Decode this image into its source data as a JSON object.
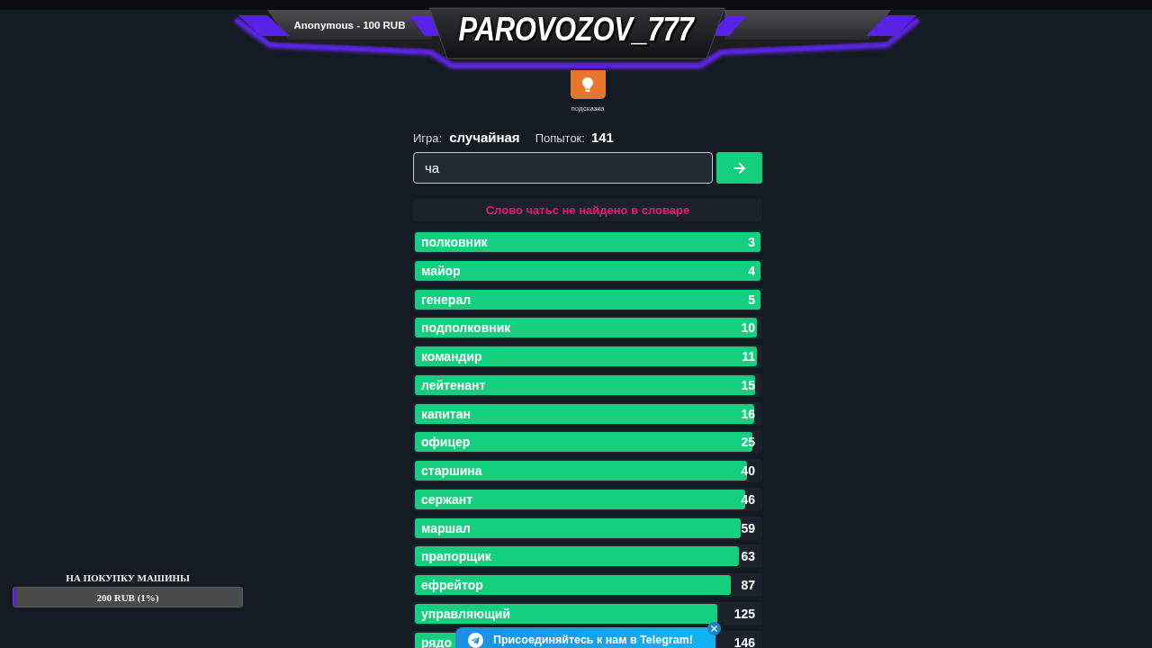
{
  "banner": {
    "subtitle": "Anonymous - 100 RUB",
    "title": "PAROVOZOV_777"
  },
  "hint": {
    "label": "подсказка"
  },
  "game_info": {
    "game_label": "Игра:",
    "game_value": "случайная",
    "attempts_label": "Попыток:",
    "attempts_value": "141"
  },
  "guess_field": {
    "value": "ча"
  },
  "error_message": "Слово чатьс не найдено в словаре",
  "guesses": [
    {
      "word": "полковник",
      "rank": "3",
      "level": 1
    },
    {
      "word": "майор",
      "rank": "4",
      "level": 1
    },
    {
      "word": "генерал",
      "rank": "5",
      "level": 1
    },
    {
      "word": "подполковник",
      "rank": "10",
      "level": 0.99
    },
    {
      "word": "командир",
      "rank": "11",
      "level": 0.99
    },
    {
      "word": "лейтенант",
      "rank": "15",
      "level": 0.985
    },
    {
      "word": "капитан",
      "rank": "16",
      "level": 0.982
    },
    {
      "word": "офицер",
      "rank": "25",
      "level": 0.977
    },
    {
      "word": "старшина",
      "rank": "40",
      "level": 0.961
    },
    {
      "word": "сержант",
      "rank": "46",
      "level": 0.956
    },
    {
      "word": "маршал",
      "rank": "59",
      "level": 0.943
    },
    {
      "word": "прапорщик",
      "rank": "63",
      "level": 0.938
    },
    {
      "word": "ефрейтор",
      "rank": "87",
      "level": 0.915
    },
    {
      "word": "управляющий",
      "rank": "125",
      "level": 0.876
    },
    {
      "word": "рядо",
      "rank": "146",
      "level": 0.86
    }
  ],
  "telegram_popup": {
    "text": "Присоединяйтесь к нам в Telegram!"
  },
  "donation_goal": {
    "title": "НА ПОКУПКУ МАШИНЫ",
    "reading": "200 RUB (1%)",
    "level": 0.01
  }
}
